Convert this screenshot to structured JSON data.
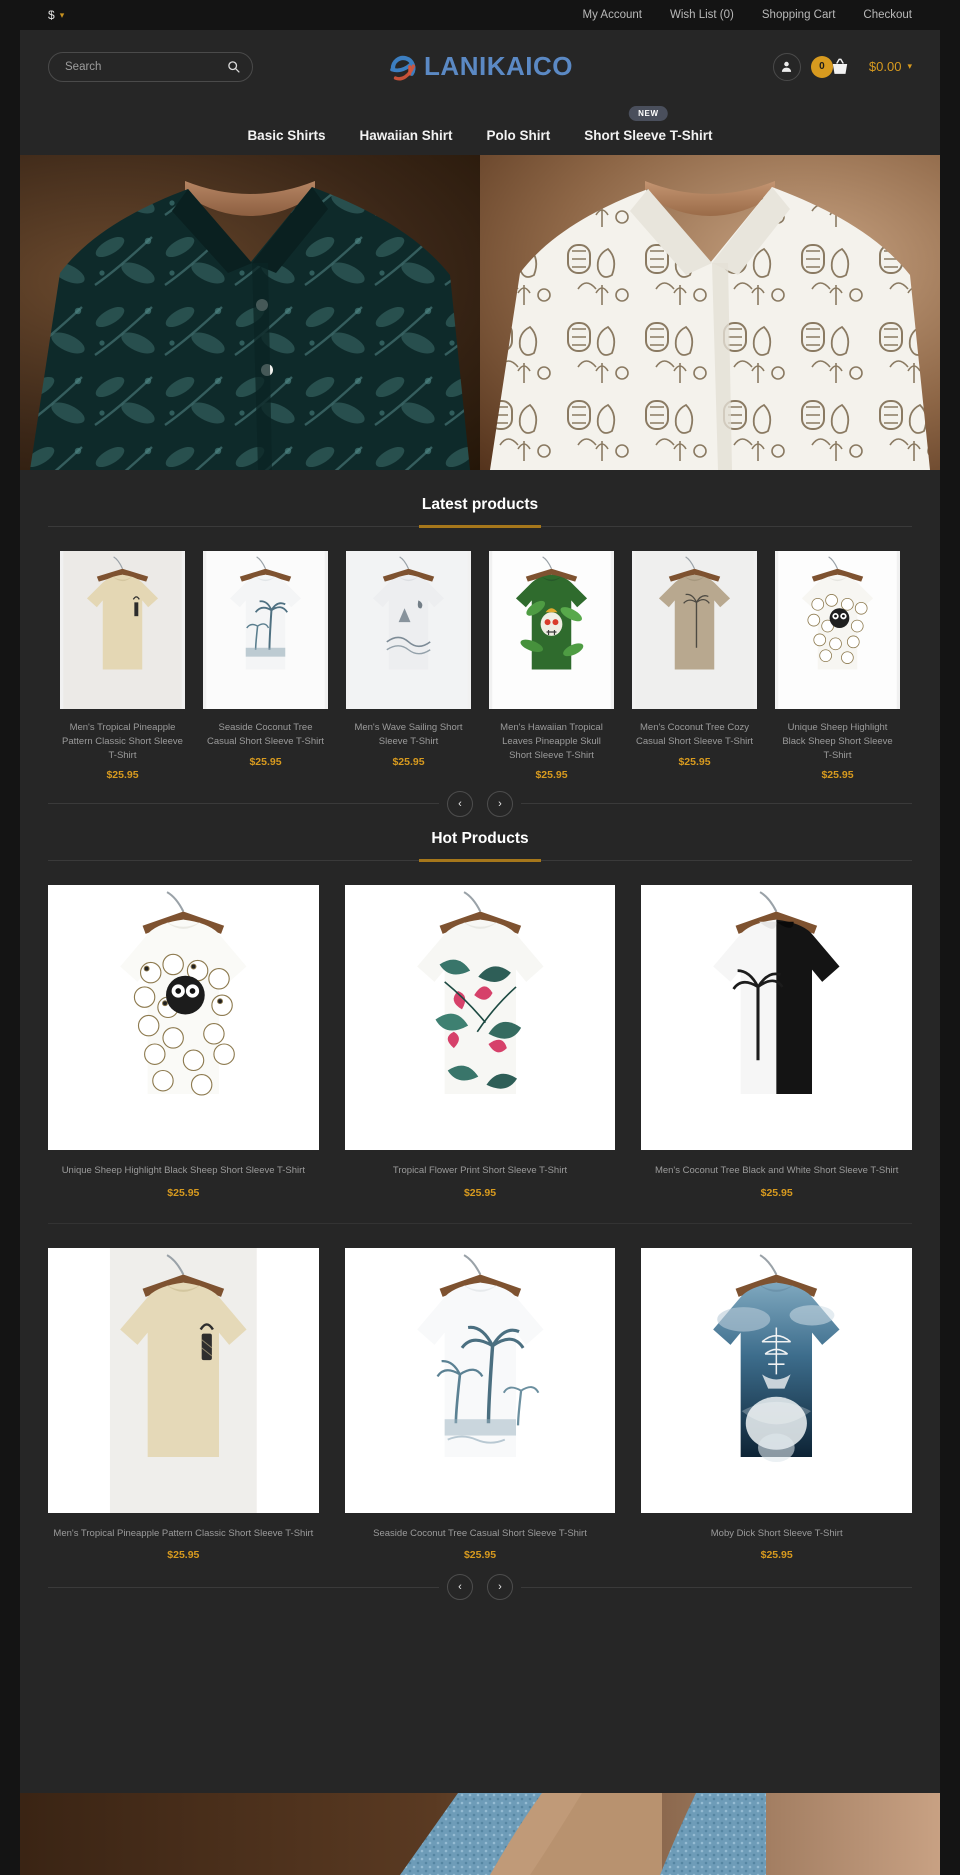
{
  "topbar": {
    "currency": "$",
    "currency_caret": "▾",
    "links": [
      {
        "label": "My Account"
      },
      {
        "label": "Wish List (0)"
      },
      {
        "label": "Shopping Cart"
      },
      {
        "label": "Checkout"
      }
    ]
  },
  "header": {
    "search": {
      "placeholder": "Search",
      "value": "",
      "icon": "search-icon"
    },
    "logo": {
      "text": "LANIKAICO",
      "mark_icon": "swoosh-e-logo-mark",
      "color": "#5b89c4",
      "accent": "#d4553a"
    },
    "account_icon": "user-icon",
    "cart": {
      "count": "0",
      "icon": "basket-icon",
      "total": "$0.00",
      "caret": "▾",
      "accent": "#d79a1f"
    }
  },
  "nav": {
    "items": [
      {
        "label": "Basic Shirts",
        "badge": ""
      },
      {
        "label": "Hawaiian Shirt",
        "badge": ""
      },
      {
        "label": "Polo Shirt",
        "badge": ""
      },
      {
        "label": "Short Sleeve T-Shirt",
        "badge": "NEW"
      }
    ]
  },
  "hero": {
    "left_alt": "man wearing dark teal floral print polo shirt",
    "right_alt": "man wearing white tiki tropical print polo shirt"
  },
  "latest": {
    "title": "Latest products",
    "prev_icon": "chevron-left-icon",
    "next_icon": "chevron-right-icon",
    "products": [
      {
        "name": "Men's Tropical Pineapple Pattern Classic Short Sleeve T-Shirt",
        "price": "$25.95",
        "style": "beige-pineapple"
      },
      {
        "name": "Seaside Coconut Tree Casual Short Sleeve T-Shirt",
        "price": "$25.95",
        "style": "white-palms"
      },
      {
        "name": "Men's Wave Sailing Short Sleeve T-Shirt",
        "price": "$25.95",
        "style": "grey-wave"
      },
      {
        "name": "Men's Hawaiian Tropical Leaves Pineapple Skull Short Sleeve T-Shirt",
        "price": "$25.95",
        "style": "green-skull"
      },
      {
        "name": "Men's Coconut Tree Cozy Casual Short Sleeve T-Shirt",
        "price": "$25.95",
        "style": "tan-palm"
      },
      {
        "name": "Unique Sheep Highlight Black Sheep Short Sleeve T-Shirt",
        "price": "$25.95",
        "style": "sheep"
      }
    ]
  },
  "hot": {
    "title": "Hot Products",
    "prev_icon": "chevron-left-icon",
    "next_icon": "chevron-right-icon",
    "products": [
      {
        "name": "Unique Sheep Highlight Black Sheep Short Sleeve T-Shirt",
        "price": "$25.95",
        "style": "sheep"
      },
      {
        "name": "Tropical Flower Print Short Sleeve T-Shirt",
        "price": "$25.95",
        "style": "flower"
      },
      {
        "name": "Men's Coconut Tree Black and White Short Sleeve T-Shirt",
        "price": "$25.95",
        "style": "bw-palm"
      },
      {
        "name": "Men's Tropical Pineapple Pattern Classic Short Sleeve T-Shirt",
        "price": "$25.95",
        "style": "beige-pineapple"
      },
      {
        "name": "Seaside Coconut Tree Casual Short Sleeve T-Shirt",
        "price": "$25.95",
        "style": "white-palms"
      },
      {
        "name": "Moby Dick Short Sleeve T-Shirt",
        "price": "$25.95",
        "style": "moby"
      }
    ]
  },
  "bottom_banner": {
    "alt": "man wearing light blue textured polo shirt"
  },
  "colors": {
    "accent": "#d79a1f",
    "underline": "#a6771b",
    "page_bg": "#141414",
    "panel_bg": "#262626",
    "logo_blue": "#5b89c4"
  }
}
